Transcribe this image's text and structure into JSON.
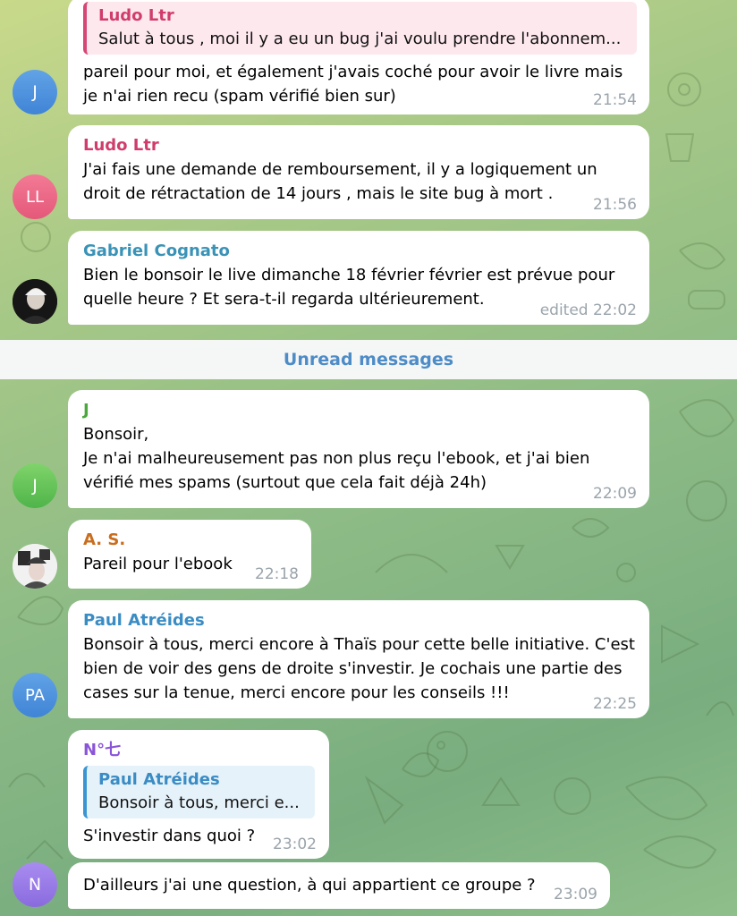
{
  "unread_label": "Unread messages",
  "messages": [
    {
      "reply": {
        "name": "Ludo Ltr",
        "text": "Salut à tous , moi il y a eu un bug j'ai voulu prendre l'abonnem..."
      },
      "text": "pareil pour moi, et également j'avais coché pour avoir le livre mais\nje n'ai rien recu (spam vérifié bien sur)",
      "time": "21:54",
      "avatar_initials": "J"
    },
    {
      "sender": "Ludo Ltr",
      "text": "J'ai fais une demande de remboursement, il y a logiquement un\ndroit de rétractation de 14 jours , mais le site bug à mort .",
      "time": "21:56",
      "avatar_initials": "LL"
    },
    {
      "sender": "Gabriel Cognato",
      "text": "Bien le bonsoir le live dimanche 18 février février est prévue pour\nquelle heure ?  Et sera-t-il regarda ultérieurement.",
      "time": "edited 22:02"
    },
    {
      "sender": "J",
      "text": "Bonsoir,\nJe n'ai malheureusement pas non plus reçu l'ebook, et j'ai bien\nvérifié mes spams (surtout que cela fait déjà 24h)",
      "time": "22:09",
      "avatar_initials": "J"
    },
    {
      "sender": "A. S.",
      "text": "Pareil pour l'ebook",
      "time": "22:18"
    },
    {
      "sender": "Paul Atréides",
      "text": "Bonsoir à tous, merci encore à Thaïs pour cette belle initiative. C'est\nbien de voir des gens de droite s'investir. Je cochais une partie des\ncases sur la tenue, merci encore pour les conseils !!!",
      "time": "22:25",
      "avatar_initials": "PA"
    },
    {
      "sender": "N°七",
      "reply": {
        "name": "Paul Atréides",
        "text": "Bonsoir à tous, merci e..."
      },
      "text": "S'investir dans quoi ?",
      "time": "23:02"
    },
    {
      "text": "D'ailleurs j'ai une question, à qui appartient ce groupe ?",
      "time": "23:09",
      "avatar_initials": "N"
    }
  ],
  "colors": {
    "ludo": "#d03d6c",
    "gabriel": "#3a93b7",
    "j_green": "#4aa83c",
    "as_orange": "#c96d1e",
    "paul": "#3a8cc4",
    "n_purple": "#8a55d8",
    "time": "#9aa4ab",
    "unread": "#4d8cc7"
  }
}
